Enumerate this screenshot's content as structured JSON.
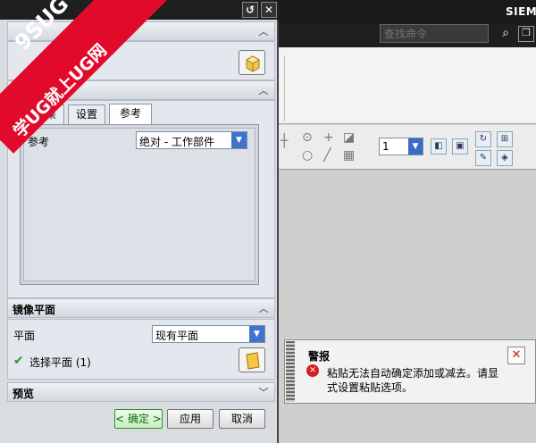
{
  "app": {
    "brand": "SIEMENS",
    "brand_visible": "SIEM"
  },
  "search": {
    "placeholder": "查找命令"
  },
  "watermark": {
    "line1": "9SUG",
    "line2": "学UG就上UG网"
  },
  "dialog": {
    "title_buttons": [
      "reset",
      "close"
    ],
    "section_filter": {
      "label": "器",
      "collapsed": false
    },
    "tabs": [
      {
        "label": "结果",
        "active": false
      },
      {
        "label": "设置",
        "active": false
      },
      {
        "label": "参考",
        "active": true
      }
    ],
    "reference": {
      "label": "参考",
      "value": "绝对 - 工作部件"
    },
    "mirror_plane": {
      "header": "镜像平面",
      "plane_label": "平面",
      "plane_value": "现有平面",
      "select_label": "选择平面 (1)"
    },
    "preview": {
      "header": "预览"
    },
    "buttons": {
      "ok": "< 确定 >",
      "apply": "应用",
      "cancel": "取消"
    }
  },
  "toolbar": {
    "number_value": "1"
  },
  "alert": {
    "title": "警报",
    "message": "粘贴无法自动确定添加或减去。请显式设置粘贴选项。"
  },
  "colors": {
    "accent_blue": "#3f73cc",
    "alert_red": "#d42020",
    "banner_red": "#e20a2a",
    "ok_green": "#126a12"
  }
}
